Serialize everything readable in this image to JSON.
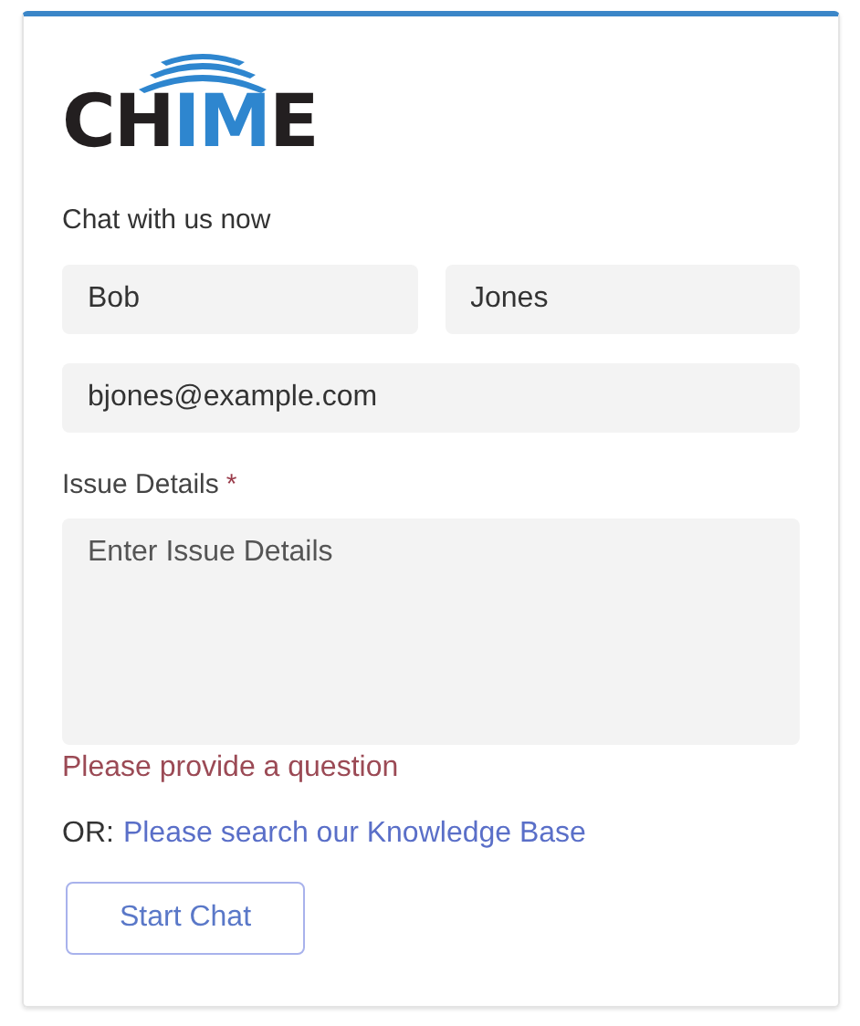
{
  "logo": [
    {
      "text": "CH",
      "color": "#231f20"
    },
    {
      "text": "IM",
      "color": "#2e86cf"
    },
    {
      "text": "E",
      "color": "#231f20"
    }
  ],
  "heading": "Chat with us now",
  "name_fields": [
    {
      "value": "Bob"
    },
    {
      "value": "Jones"
    }
  ],
  "email_field": {
    "value": "bjones@example.com"
  },
  "issue": {
    "label": "Issue Details",
    "required_mark": "*",
    "placeholder": "Enter Issue Details",
    "error": "Please provide a question"
  },
  "alternative": {
    "prefix": "OR:",
    "link": "Please search our Knowledge Base"
  },
  "buttons": [
    {
      "label": "Start Chat"
    }
  ]
}
